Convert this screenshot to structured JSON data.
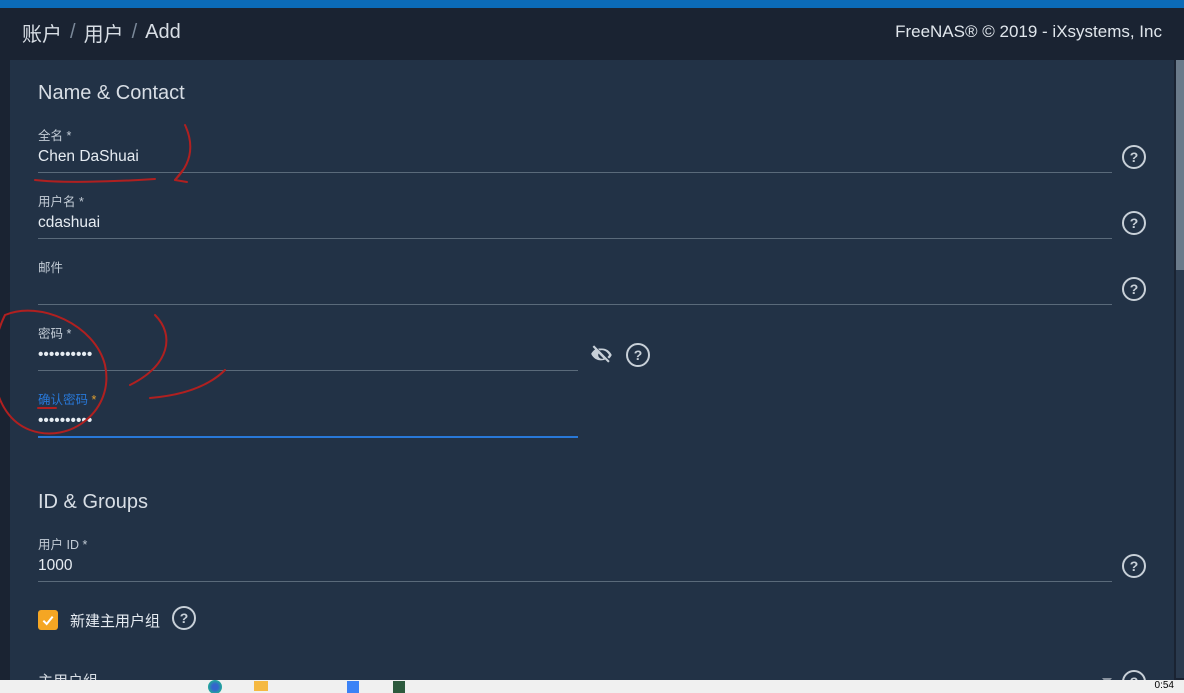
{
  "breadcrumb": {
    "items": [
      "账户",
      "用户",
      "Add"
    ]
  },
  "copyright": "FreeNAS® © 2019 - iXsystems, Inc",
  "sections": {
    "nameContact": {
      "title": "Name & Contact",
      "fullname": {
        "label": "全名",
        "required": "*",
        "value": "Chen DaShuai"
      },
      "username": {
        "label": "用户名",
        "required": "*",
        "value": "cdashuai"
      },
      "email": {
        "label": "邮件",
        "required": "",
        "value": ""
      },
      "password": {
        "label": "密码",
        "required": "*",
        "value": "••••••••••"
      },
      "confirm": {
        "label": "确认密码",
        "required": "*",
        "value": "••••••••••"
      }
    },
    "idGroups": {
      "title": "ID & Groups",
      "userid": {
        "label": "用户 ID",
        "required": "*",
        "value": "1000"
      },
      "newPrimaryGroup": {
        "label": "新建主用户组",
        "checked": true
      },
      "primaryGroup": {
        "label": "主用户组"
      }
    }
  },
  "taskbar": {
    "time": "0:54"
  }
}
